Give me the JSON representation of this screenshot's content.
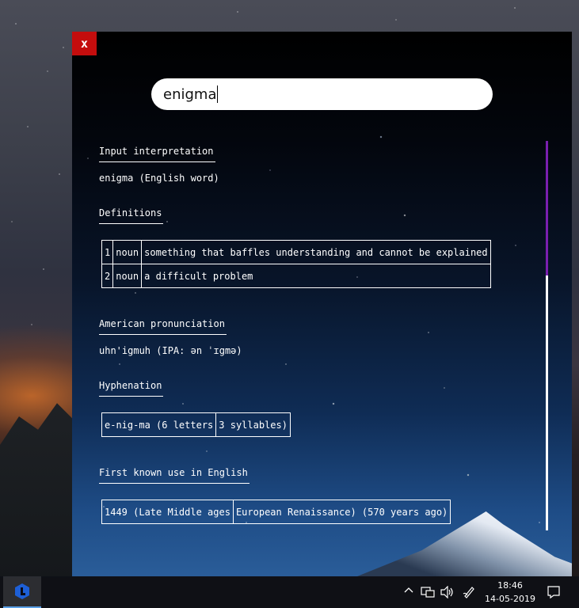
{
  "window": {
    "close_label": "x"
  },
  "search": {
    "value": "enigma"
  },
  "sections": {
    "input_interpretation": {
      "heading": "Input interpretation",
      "text": "enigma (English word)"
    },
    "definitions": {
      "heading": "Definitions",
      "rows": [
        {
          "num": "1",
          "pos": "noun",
          "text": "something that baffles understanding and cannot be explained"
        },
        {
          "num": "2",
          "pos": "noun",
          "text": "a difficult problem"
        }
      ]
    },
    "pronunciation": {
      "heading": "American pronunciation",
      "text": "uhn'igmuh (IPA: ən ˈɪgmə)"
    },
    "hyphenation": {
      "heading": "Hyphenation",
      "cells": [
        "e-nig-ma (6 letters",
        "3 syllables)"
      ]
    },
    "first_use": {
      "heading": "First known use in English",
      "cells": [
        "1449 (Late Middle ages",
        "European Renaissance) (570 years ago)"
      ]
    }
  },
  "scrollbar": {
    "thumb_color": "#7a1fb0",
    "track_color": "#ffffff"
  },
  "taskbar": {
    "app_icon": "app-logo-icon",
    "tray_icons": [
      "chevron-up-icon",
      "network-icon",
      "volume-icon",
      "pen-icon"
    ],
    "time": "18:46",
    "date": "14-05-2019",
    "notification_icon": "notification-icon"
  },
  "colors": {
    "close_button": "#c40d0d",
    "accent": "#5aa0e6"
  }
}
